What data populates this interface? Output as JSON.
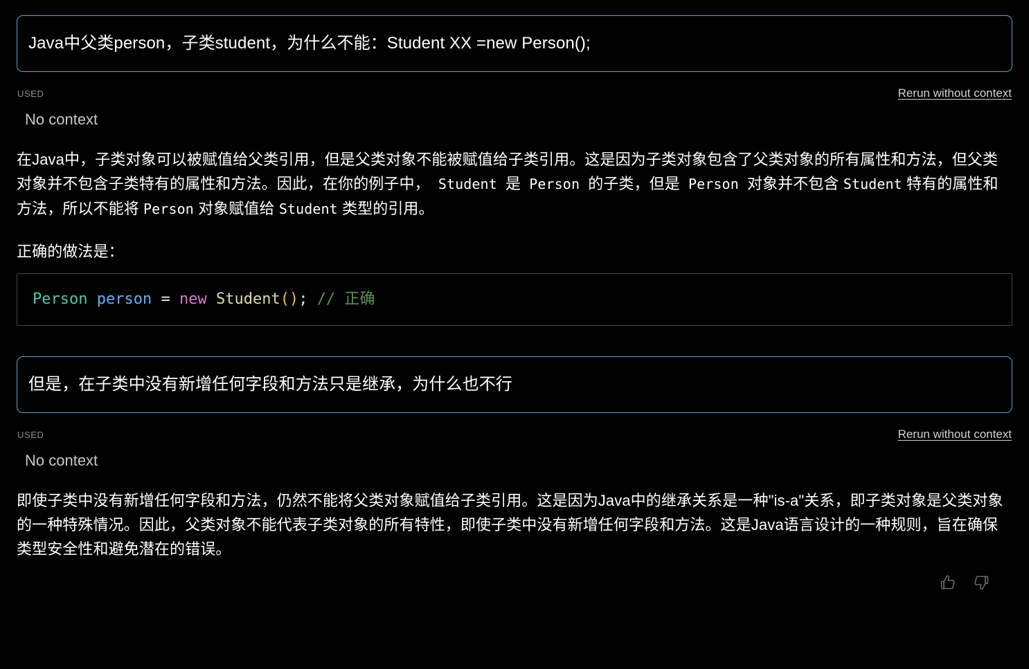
{
  "theme": {
    "background": "#000000",
    "text": "#ffffff",
    "prompt_border": "#5aa5c9",
    "code_border": "#454545",
    "muted": "#8d8d8d",
    "link": "#d2d2d2",
    "icon": "#6e6e6e"
  },
  "turns": [
    {
      "prompt": "Java中父类person，子类student，为什么不能：Student XX =new Person();",
      "context": {
        "used_label": "USED",
        "rerun_label": "Rerun without context",
        "value": "No context"
      },
      "answer_paragraphs": [
        {
          "segments": [
            {
              "type": "text",
              "value": "在Java中，子类对象可以被赋值给父类引用，但是父类对象不能被赋值给子类引用。这是因为子类对象包含了父类对象的所有属性和方法，但父类对象并不包含子类特有的属性和方法。因此，在你的例子中，"
            },
            {
              "type": "code",
              "value": " Student "
            },
            {
              "type": "text",
              "value": "是"
            },
            {
              "type": "code",
              "value": " Person "
            },
            {
              "type": "text",
              "value": "的子类，但是"
            },
            {
              "type": "code",
              "value": " Person "
            },
            {
              "type": "text",
              "value": "对象并不包含 "
            },
            {
              "type": "code",
              "value": "Student"
            },
            {
              "type": "text",
              "value": " 特有的属性和方法，所以不能将 "
            },
            {
              "type": "code",
              "value": "Person"
            },
            {
              "type": "text",
              "value": " 对象赋值给 "
            },
            {
              "type": "code",
              "value": "Student"
            },
            {
              "type": "text",
              "value": " 类型的引用。"
            }
          ]
        },
        {
          "segments": [
            {
              "type": "text",
              "value": "正确的做法是："
            }
          ]
        }
      ],
      "code_block": {
        "language": "java",
        "tokens": [
          {
            "cls": "tok-type",
            "value": "Person"
          },
          {
            "cls": "tok-op",
            "value": " "
          },
          {
            "cls": "tok-var",
            "value": "person"
          },
          {
            "cls": "tok-op",
            "value": " = "
          },
          {
            "cls": "tok-kw",
            "value": "new"
          },
          {
            "cls": "tok-op",
            "value": " "
          },
          {
            "cls": "tok-fn",
            "value": "Student"
          },
          {
            "cls": "tok-paren",
            "value": "()"
          },
          {
            "cls": "tok-punc",
            "value": ";"
          },
          {
            "cls": "tok-op",
            "value": " "
          },
          {
            "cls": "tok-comment",
            "value": "// 正确"
          }
        ],
        "plain": "Person person = new Student(); // 正确"
      },
      "feedback": null
    },
    {
      "prompt": "但是，在子类中没有新增任何字段和方法只是继承，为什么也不行",
      "context": {
        "used_label": "USED",
        "rerun_label": "Rerun without context",
        "value": "No context"
      },
      "answer_paragraphs": [
        {
          "segments": [
            {
              "type": "text",
              "value": "即使子类中没有新增任何字段和方法，仍然不能将父类对象赋值给子类引用。这是因为Java中的继承关系是一种\"is-a\"关系，即子类对象是父类对象的一种特殊情况。因此，父类对象不能代表子类对象的所有特性，即使子类中没有新增任何字段和方法。这是Java语言设计的一种规则，旨在确保类型安全性和避免潜在的错误。"
            }
          ]
        }
      ],
      "code_block": null,
      "feedback": {
        "thumbs_up": "thumbs-up-icon",
        "thumbs_down": "thumbs-down-icon"
      }
    }
  ]
}
